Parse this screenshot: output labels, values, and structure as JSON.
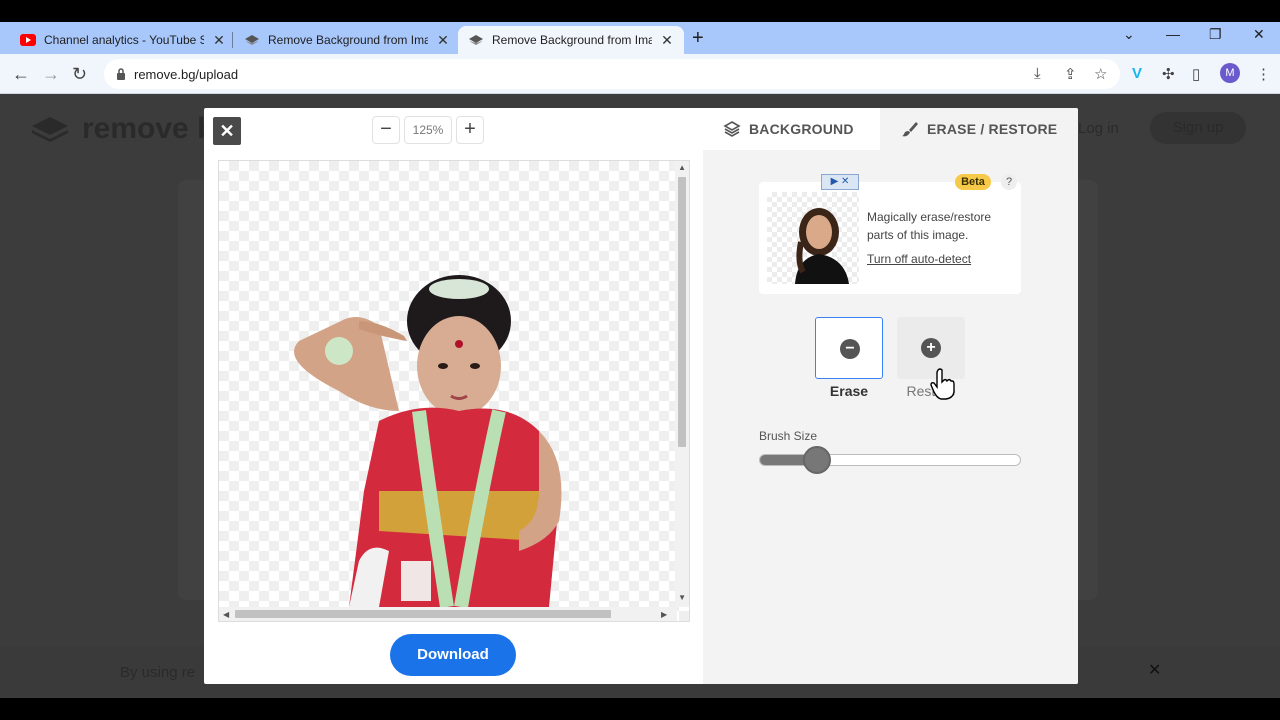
{
  "browser": {
    "tabs": [
      {
        "title": "Channel analytics - YouTube Stu",
        "favicon": "youtube-icon"
      },
      {
        "title": "Remove Background from Imag",
        "favicon": "removebg-icon"
      },
      {
        "title": "Remove Background from Imag",
        "favicon": "removebg-icon"
      }
    ],
    "url": "remove.bg/upload",
    "profile_initial": "M"
  },
  "page": {
    "logo_text": "remove b",
    "login": "Log in",
    "signup": "Sign up",
    "cookie_text": "By using re"
  },
  "editor": {
    "zoom_value": "125%",
    "download_label": "Download",
    "tabs": {
      "background": "BACKGROUND",
      "erase_restore": "ERASE / RESTORE"
    },
    "info": {
      "beta": "Beta",
      "help": "?",
      "description": "Magically erase/restore parts of this image.",
      "link": "Turn off auto-detect"
    },
    "tools": {
      "erase": "Erase",
      "restore": "Restore"
    },
    "brush_size_label": "Brush Size",
    "brush_size_level": 0.22,
    "colors": {
      "accent": "#1a73e8",
      "beta": "#f7c948",
      "selected_border": "#3b82f6"
    }
  }
}
